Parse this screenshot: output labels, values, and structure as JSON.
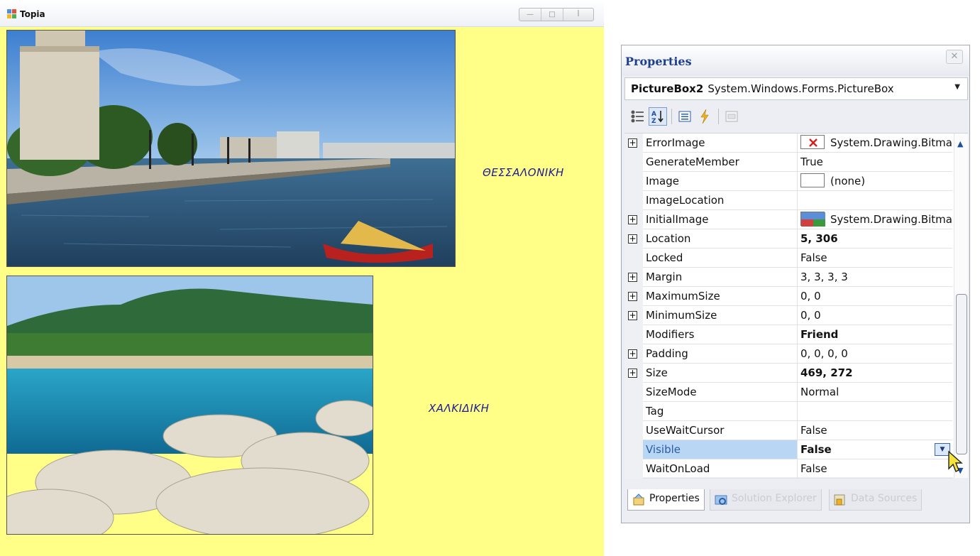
{
  "form": {
    "title": "Topia",
    "window_buttons": {
      "minimize": "—",
      "maximize": "□",
      "close": "ꟾ"
    },
    "label1": "ΘΕΣΣΑΛΟΝΙΚΗ",
    "label2": "ΧΑΛΚΙΔΙΚΗ"
  },
  "properties": {
    "title": "Properties",
    "close": "✕",
    "object_name": "PictureBox2",
    "object_type": "System.Windows.Forms.PictureBox",
    "dropdown_arrow": "▼",
    "rows": [
      {
        "name": "ErrorImage",
        "value": "System.Drawing.Bitma",
        "expandable": true,
        "icon": "error-image-icon"
      },
      {
        "name": "GenerateMember",
        "value": "True"
      },
      {
        "name": "Image",
        "value": "(none)",
        "icon": "empty-image-icon"
      },
      {
        "name": "ImageLocation",
        "value": ""
      },
      {
        "name": "InitialImage",
        "value": "System.Drawing.Bitma",
        "expandable": true,
        "icon": "initial-image-icon"
      },
      {
        "name": "Location",
        "value": "5, 306",
        "expandable": true,
        "bold": true
      },
      {
        "name": "Locked",
        "value": "False"
      },
      {
        "name": "Margin",
        "value": "3, 3, 3, 3",
        "expandable": true
      },
      {
        "name": "MaximumSize",
        "value": "0, 0",
        "expandable": true
      },
      {
        "name": "MinimumSize",
        "value": "0, 0",
        "expandable": true
      },
      {
        "name": "Modifiers",
        "value": "Friend",
        "bold": true
      },
      {
        "name": "Padding",
        "value": "0, 0, 0, 0",
        "expandable": true
      },
      {
        "name": "Size",
        "value": "469, 272",
        "expandable": true,
        "bold": true
      },
      {
        "name": "SizeMode",
        "value": "Normal"
      },
      {
        "name": "Tag",
        "value": ""
      },
      {
        "name": "UseWaitCursor",
        "value": "False"
      },
      {
        "name": "Visible",
        "value": "False",
        "bold": true,
        "selected": true
      },
      {
        "name": "WaitOnLoad",
        "value": "False"
      }
    ],
    "expander_symbol": "+",
    "tabs": [
      {
        "label": "Properties",
        "active": true
      },
      {
        "label": "Solution Explorer",
        "active": false
      },
      {
        "label": "Data Sources",
        "active": false
      }
    ]
  }
}
